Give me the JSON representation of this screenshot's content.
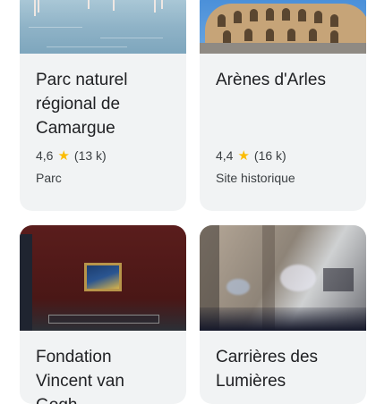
{
  "cards": [
    {
      "title": "Parc naturel régional de Camargue",
      "rating": "4,6",
      "reviews": "(13 k)",
      "category": "Parc",
      "image_icon": "lagoon-with-flamingos-image"
    },
    {
      "title": "Arènes d'Arles",
      "rating": "4,4",
      "reviews": "(16 k)",
      "category": "Site historique",
      "image_icon": "roman-amphitheatre-image"
    },
    {
      "title": "Fondation Vincent van Gogh",
      "image_icon": "gallery-painting-image"
    },
    {
      "title": "Carrières des Lumières",
      "image_icon": "light-show-quarry-image"
    }
  ],
  "star_glyph": "★",
  "colors": {
    "star": "#fbbc04",
    "card_bg": "#f1f3f4",
    "text": "#202124"
  }
}
